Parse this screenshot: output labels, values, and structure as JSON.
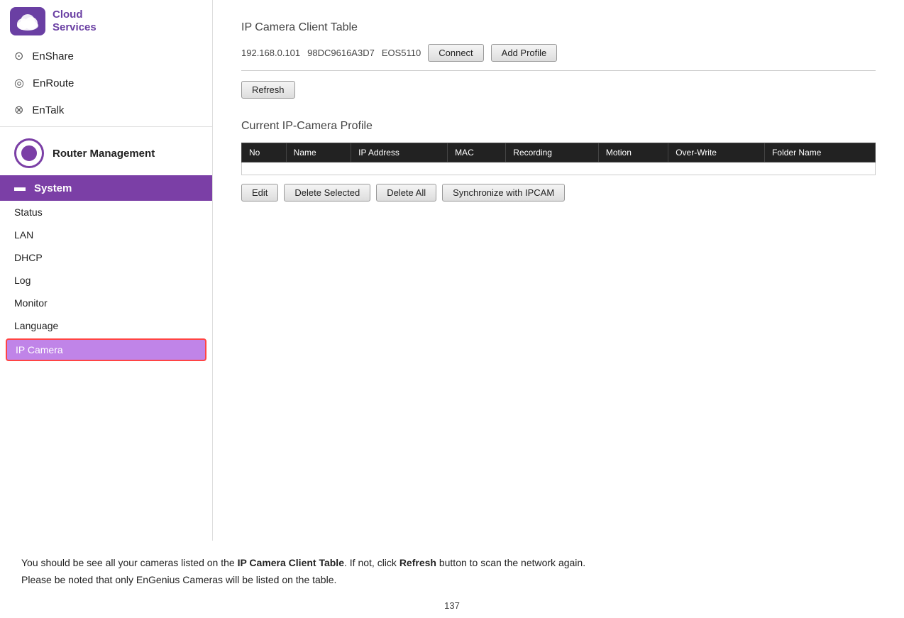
{
  "sidebar": {
    "logo": {
      "title_line1": "Cloud",
      "title_line2": "Services"
    },
    "nav_items": [
      {
        "id": "enshare",
        "label": "EnShare",
        "icon": "⊙"
      },
      {
        "id": "enroute",
        "label": "EnRoute",
        "icon": "◎"
      },
      {
        "id": "entalk",
        "label": "EnTalk",
        "icon": "⊗"
      }
    ],
    "router_management_label": "Router Management",
    "system_label": "System",
    "sub_items": [
      {
        "id": "status",
        "label": "Status"
      },
      {
        "id": "lan",
        "label": "LAN"
      },
      {
        "id": "dhcp",
        "label": "DHCP"
      },
      {
        "id": "log",
        "label": "Log"
      },
      {
        "id": "monitor",
        "label": "Monitor"
      },
      {
        "id": "language",
        "label": "Language"
      },
      {
        "id": "ipcamera",
        "label": "IP Camera",
        "active": true
      }
    ]
  },
  "content": {
    "client_table_title": "IP Camera Client Table",
    "client_row": {
      "ip": "192.168.0.101",
      "mac": "98DC9616A3D7",
      "model": "EOS5110"
    },
    "connect_btn": "Connect",
    "add_profile_btn": "Add Profile",
    "refresh_btn": "Refresh",
    "profile_section_title": "Current IP-Camera Profile",
    "profile_table_headers": [
      "No",
      "Name",
      "IP Address",
      "MAC",
      "Recording",
      "Motion",
      "Over-Write",
      "Folder Name"
    ],
    "profile_actions": {
      "edit": "Edit",
      "delete_selected": "Delete Selected",
      "delete_all": "Delete All",
      "synchronize": "Synchronize with IPCAM"
    }
  },
  "bottom_text": {
    "line1_prefix": "You should be see all your cameras listed on the ",
    "line1_bold": "IP Camera Client Table",
    "line1_suffix": ". If not, click ",
    "line1_bold2": "Refresh",
    "line1_suffix2": " button to scan the network again.",
    "line2": "Please be noted that only EnGenius Cameras will be listed on the table."
  },
  "page_number": "137"
}
